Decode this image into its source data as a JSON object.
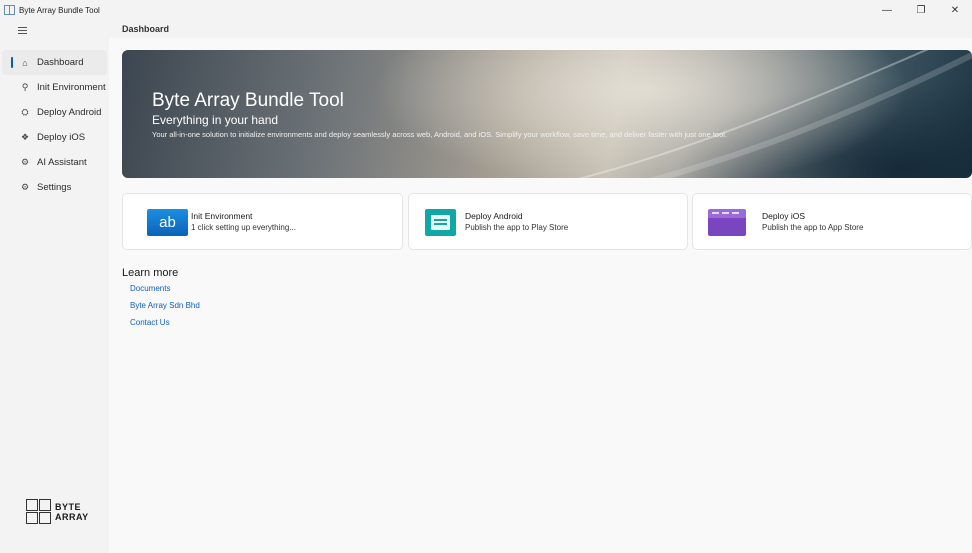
{
  "window": {
    "title": "Byte Array Bundle Tool",
    "controls": {
      "minimize": "—",
      "restore": "❐",
      "close": "✕"
    }
  },
  "sidebar": {
    "menu_icon": "hamburger-icon",
    "items": [
      {
        "label": "Dashboard",
        "icon": "home-icon",
        "glyph": "⌂"
      },
      {
        "label": "Init Environment",
        "icon": "plug-icon",
        "glyph": "⚲"
      },
      {
        "label": "Deploy Android",
        "icon": "android-icon",
        "glyph": "⛭"
      },
      {
        "label": "Deploy iOS",
        "icon": "apple-icon",
        "glyph": "❖"
      },
      {
        "label": "AI Assistant",
        "icon": "robot-icon",
        "glyph": "⚙"
      },
      {
        "label": "Settings",
        "icon": "gear-icon",
        "glyph": "⚙"
      }
    ],
    "logo": {
      "line1": "BYTE",
      "line2": "ARRAY"
    }
  },
  "main": {
    "title": "Dashboard",
    "hero": {
      "title": "Byte Array Bundle Tool",
      "subtitle": "Everything in your hand",
      "description": "Your all-in-one solution to initialize environments and deploy seamlessly across web, Android, and iOS. Simplify your workflow, save time, and deliver faster with just one tool."
    },
    "cards": [
      {
        "title": "Init Environment",
        "description": "1 click setting up everything...",
        "icon_text": "ab"
      },
      {
        "title": "Deploy Android",
        "description": "Publish the app to Play Store"
      },
      {
        "title": "Deploy iOS",
        "description": "Publish the app to App Store"
      }
    ],
    "learn_more": {
      "title": "Learn more",
      "links": [
        "Documents",
        "Byte Array Sdn Bhd",
        "Contact Us"
      ]
    }
  },
  "colors": {
    "accent": "#005fb8",
    "link": "#0f5fc2",
    "android": "#10a8a6",
    "ios": "#7a46bf",
    "ab": "#0a63b8"
  }
}
